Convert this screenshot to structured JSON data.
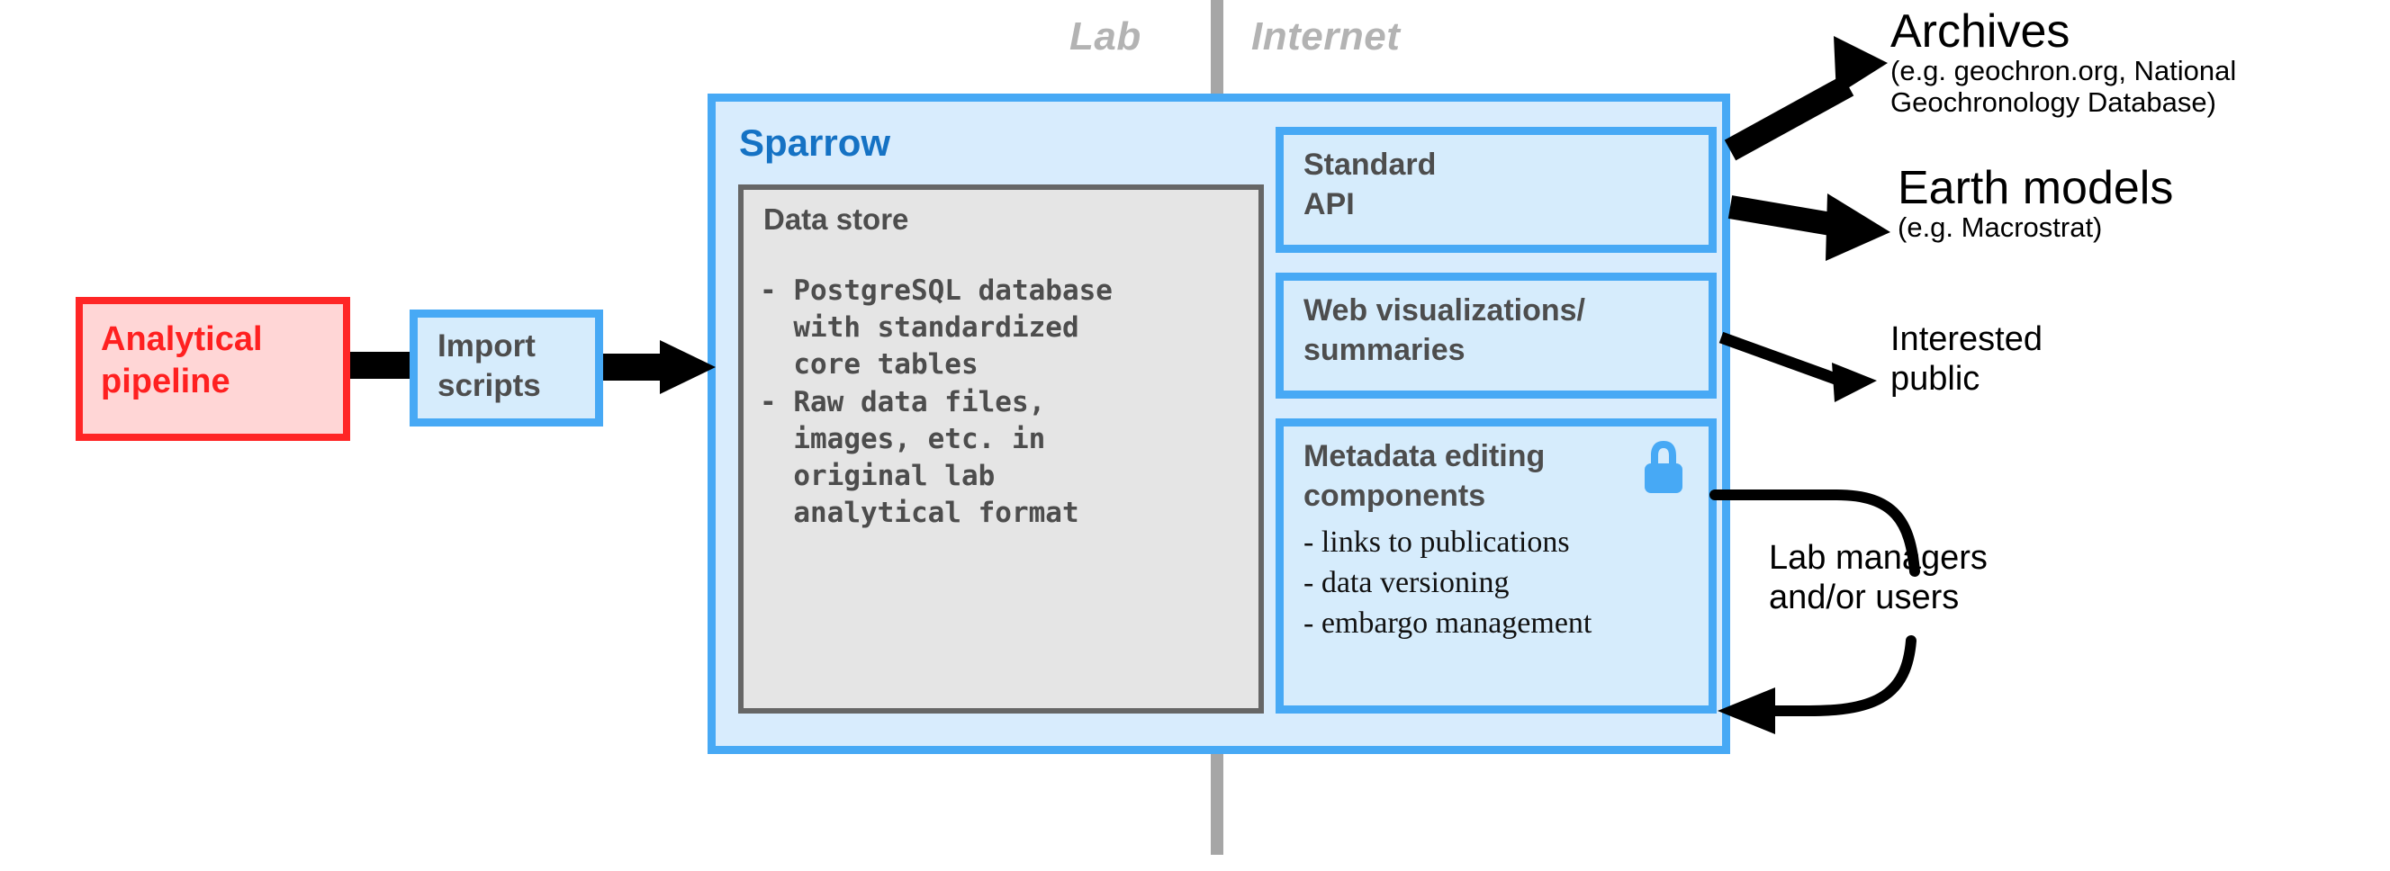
{
  "zones": {
    "lab": "Lab",
    "internet": "Internet"
  },
  "analytical_pipeline": {
    "label": "Analytical\npipeline",
    "border_color": "#ff2626",
    "fill_color": "#ffd6d6",
    "text_color": "#ff2020"
  },
  "import_scripts": {
    "label": "Import\nscripts",
    "border_color": "#47a9f5",
    "fill_color": "#d6ecfc",
    "text_color": "#4d4d4d"
  },
  "sparrow": {
    "title": "Sparrow",
    "title_color": "#1572c4",
    "border_color": "#47a9f5",
    "fill_color": "#d8ecfd",
    "data_store": {
      "title": "Data store",
      "border_color": "#666666",
      "fill_color": "#e5e5e5",
      "items": [
        "- PostgreSQL database",
        "  with standardized",
        "  core tables",
        "- Raw data files,",
        "  images, etc. in",
        "  original lab",
        "  analytical format"
      ]
    },
    "services": [
      {
        "name": "standard-api",
        "title": "Standard\nAPI"
      },
      {
        "name": "web-visualizations",
        "title": "Web visualizations/\nsummaries"
      },
      {
        "name": "metadata-editing",
        "title": "Metadata editing\ncomponents",
        "icon": "lock-icon",
        "icon_color": "#47a9f5",
        "bullets": [
          "- links to publications",
          "- data versioning",
          "- embargo management"
        ]
      }
    ]
  },
  "destinations": [
    {
      "name": "archives",
      "title": "Archives",
      "subtitle": "(e.g. geochron.org, National\nGeochronology Database)"
    },
    {
      "name": "earth-models",
      "title": "Earth models",
      "subtitle": "(e.g. Macrostrat)"
    },
    {
      "name": "interested-public",
      "title": "Interested\npublic",
      "subtitle": ""
    },
    {
      "name": "lab-managers",
      "title": "Lab managers\nand/or users",
      "subtitle": ""
    }
  ],
  "colors": {
    "accent_blue": "#47a9f5",
    "light_blue_fill": "#d6ecfc",
    "sparrow_blue": "#1572c4",
    "divider_gray": "#a6a6a6",
    "arrow_black": "#000000",
    "red": "#ff2626"
  }
}
